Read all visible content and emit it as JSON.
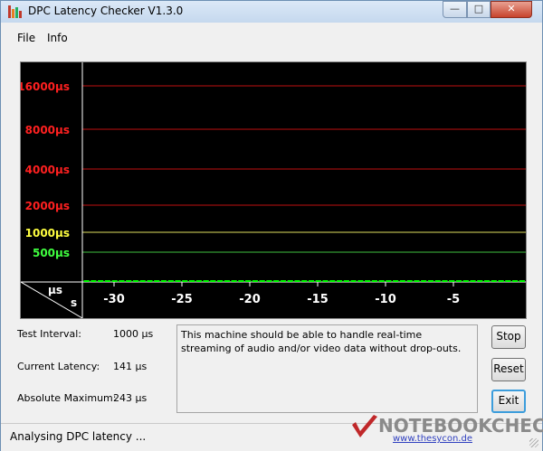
{
  "window": {
    "title": "DPC Latency Checker V1.3.0"
  },
  "titlebar_buttons": {
    "minimize": "—",
    "maximize": "□",
    "close": "✕"
  },
  "menu": {
    "file": "File",
    "info": "Info"
  },
  "chart_data": {
    "type": "bar",
    "y_tick_labels": [
      {
        "label": "16000µs",
        "color": "#ff2020"
      },
      {
        "label": "8000µs",
        "color": "#ff2020"
      },
      {
        "label": "4000µs",
        "color": "#ff2020"
      },
      {
        "label": "2000µs",
        "color": "#ff2020"
      },
      {
        "label": "1000µs",
        "color": "#ffff40"
      },
      {
        "label": "500µs",
        "color": "#40ff40"
      }
    ],
    "y_unit": "µs",
    "x_unit": "s",
    "x_tick_labels": [
      "-30",
      "-25",
      "-20",
      "-15",
      "-10",
      "-5"
    ],
    "bar_color": "#00ff00",
    "values": [
      141,
      141,
      136,
      141,
      218,
      136,
      141,
      141,
      141,
      136,
      141,
      141,
      141,
      141,
      141,
      141,
      136,
      141,
      141,
      141,
      141,
      136,
      141,
      141,
      141,
      136,
      141,
      141,
      141,
      141,
      141,
      141,
      141,
      141,
      141,
      141,
      141,
      141,
      141,
      141,
      136,
      141,
      141,
      141,
      141,
      141,
      141,
      141,
      141,
      141,
      141,
      141,
      141,
      141,
      141,
      141,
      141,
      243,
      141,
      141,
      141,
      141,
      141
    ],
    "values_note_unused": ""
  },
  "info": {
    "test_interval_label": "Test Interval:",
    "test_interval_value": "1000 µs",
    "current_latency_label": "Current Latency:",
    "current_latency_value": "141 µs",
    "absolute_max_label": "Absolute Maximum:",
    "absolute_max_value": "243 µs"
  },
  "message": "This machine should be able to handle real-time streaming of audio and/or video data without drop-outs.",
  "buttons": {
    "stop": "Stop",
    "reset": "Reset",
    "exit": "Exit"
  },
  "status": "Analysing DPC latency ...",
  "watermark": {
    "text": "NOTEBOOKCHECK",
    "url": "www.thesycon.de"
  }
}
